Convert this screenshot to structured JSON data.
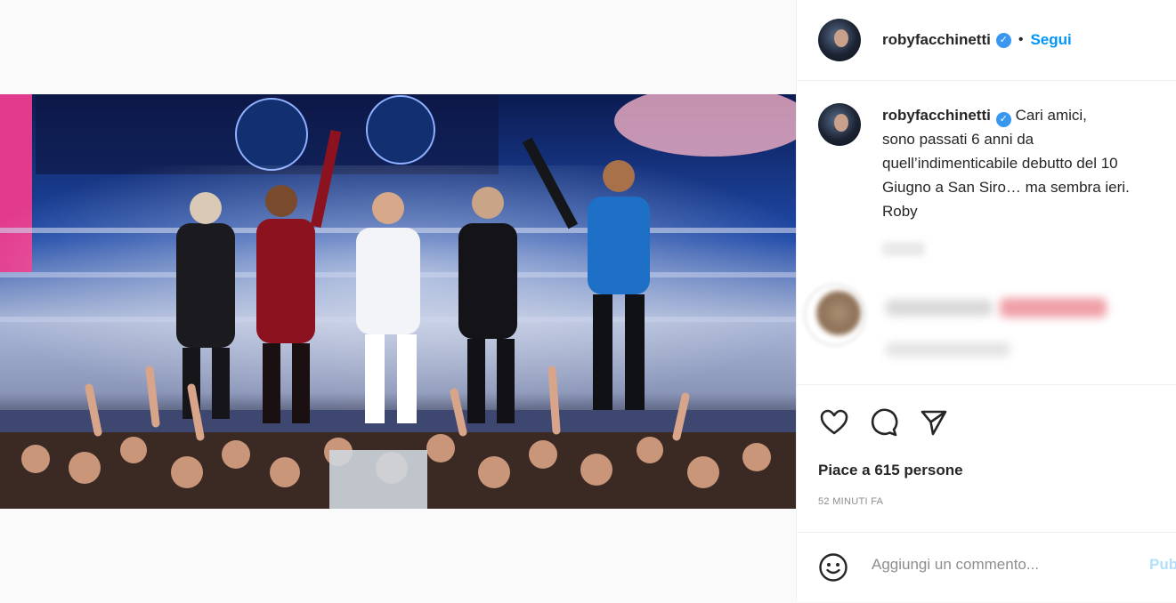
{
  "post": {
    "username": "robyfacchinetti",
    "follow_label": "Segui",
    "separator": "•",
    "caption_username": "robyfacchinetti",
    "caption_lines": [
      "Cari amici,",
      "sono passati 6 anni da",
      "quell’indimenticabile debutto del 10",
      "Giugno a San Siro… ma sembra ieri.",
      "Roby"
    ],
    "likes_text": "Piace a 615 persone",
    "time_ago": "52 MINUTI FA",
    "comment_placeholder": "Aggiungi un commento...",
    "publish_label": "Pubblica"
  },
  "icons": {
    "verified": "verified-badge-icon",
    "like": "heart-icon",
    "comment": "comment-icon",
    "share": "paper-plane-icon",
    "emoji": "emoji-icon"
  },
  "colors": {
    "link_blue": "#0095f6",
    "verified_blue": "#3897f0",
    "publish_disabled": "#b2dffc",
    "secondary_text": "#8e8e8e"
  }
}
